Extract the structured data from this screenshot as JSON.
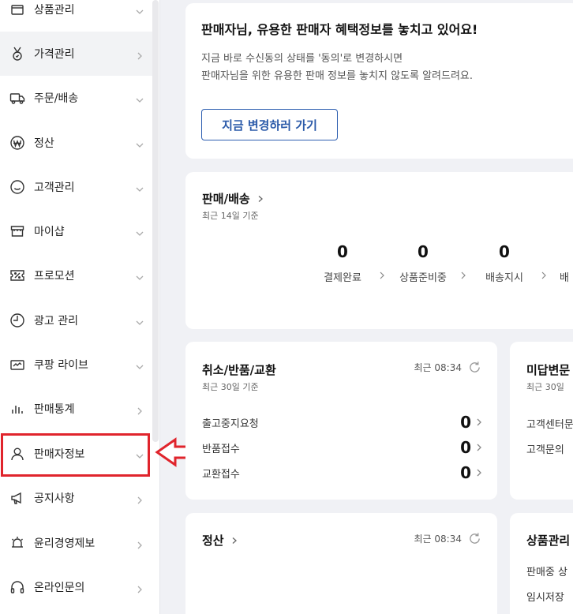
{
  "sidebar": {
    "items": [
      {
        "label": "상품관리",
        "icon": "product-icon",
        "expand": "chevron-down"
      },
      {
        "label": "가격관리",
        "icon": "medal-icon",
        "expand": "chevron-right"
      },
      {
        "label": "주문/배송",
        "icon": "truck-icon",
        "expand": "chevron-down"
      },
      {
        "label": "정산",
        "icon": "won-icon",
        "expand": "chevron-down"
      },
      {
        "label": "고객관리",
        "icon": "smile-icon",
        "expand": "chevron-down"
      },
      {
        "label": "마이샵",
        "icon": "shop-icon",
        "expand": "chevron-down"
      },
      {
        "label": "프로모션",
        "icon": "coupon-icon",
        "expand": "chevron-down"
      },
      {
        "label": "광고 관리",
        "icon": "clock-icon",
        "expand": "chevron-down"
      },
      {
        "label": "쿠팡 라이브",
        "icon": "live-icon",
        "expand": "chevron-down"
      },
      {
        "label": "판매통계",
        "icon": "bar-chart-icon",
        "expand": "chevron-right"
      },
      {
        "label": "판매자정보",
        "icon": "person-icon",
        "expand": "chevron-down"
      },
      {
        "label": "공지사항",
        "icon": "megaphone-icon",
        "expand": "chevron-right"
      },
      {
        "label": "윤리경영제보",
        "icon": "alarm-icon",
        "expand": "chevron-right"
      },
      {
        "label": "온라인문의",
        "icon": "headset-icon",
        "expand": "chevron-right"
      }
    ]
  },
  "notice": {
    "title": "판매자님, 유용한 판매자 혜택정보를 놓치고 있어요!",
    "line1": "지금 바로 수신동의 상태를 '동의'로 변경하시면",
    "line2": "판매자님을 위한 유용한 판매 정보를 놓치지 않도록 알려드려요.",
    "button": "지금 변경하러 가기"
  },
  "sales": {
    "title": "판매/배송",
    "subtitle": "최근 14일 기준",
    "stats": [
      {
        "value": "0",
        "label": "결제완료"
      },
      {
        "value": "0",
        "label": "상품준비중"
      },
      {
        "value": "0",
        "label": "배송지시"
      },
      {
        "value": "",
        "label": "배"
      }
    ]
  },
  "returns": {
    "title": "취소/반품/교환",
    "subtitle": "최근 30일 기준",
    "recent": "최근 08:34",
    "rows": [
      {
        "label": "출고중지요청",
        "value": "0"
      },
      {
        "label": "반품접수",
        "value": "0"
      },
      {
        "label": "교환접수",
        "value": "0"
      }
    ]
  },
  "unanswered": {
    "title": "미답변문",
    "subtitle": "최근 30일",
    "rows": [
      "고객센터문",
      "고객문의"
    ]
  },
  "settlement": {
    "title": "정산",
    "recent": "최근 08:34"
  },
  "product_mgmt": {
    "title": "상품관리",
    "rows": [
      "판매중 상",
      "임시저장"
    ]
  },
  "colors": {
    "highlight": "#e0242c",
    "button_border": "#2e5fb0",
    "background": "#f0f1f5"
  }
}
